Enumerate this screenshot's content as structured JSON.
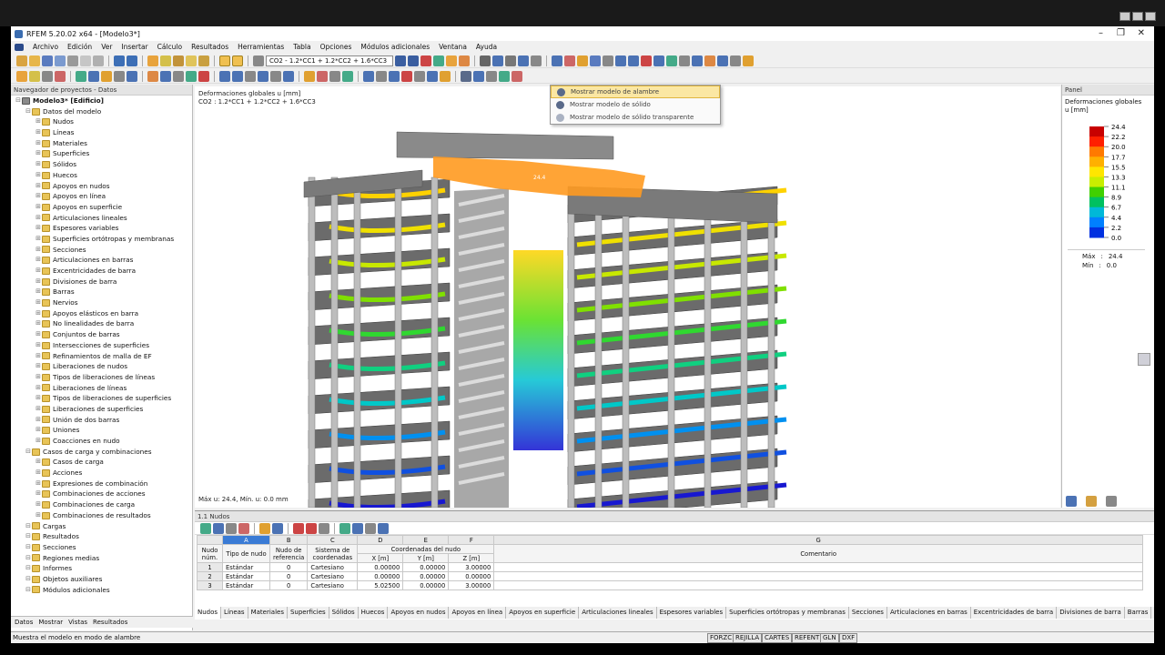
{
  "window": {
    "title": "RFEM 5.20.02 x64 - [Modelo3*]"
  },
  "menu": [
    "Archivo",
    "Edición",
    "Ver",
    "Insertar",
    "Cálculo",
    "Resultados",
    "Herramientas",
    "Tabla",
    "Opciones",
    "Módulos adicionales",
    "Ventana",
    "Ayuda"
  ],
  "toolbar": {
    "load_combo": "CO2 - 1.2*CC1 + 1.2*CC2 + 1.6*CC3"
  },
  "navigator": {
    "title": "Navegador de proyectos - Datos",
    "items": [
      {
        "label": "Modelo3* [Edificio]",
        "level": 0,
        "bold": true
      },
      {
        "label": "Datos del modelo",
        "level": 1
      },
      {
        "label": "Nudos",
        "level": 2
      },
      {
        "label": "Líneas",
        "level": 2
      },
      {
        "label": "Materiales",
        "level": 2
      },
      {
        "label": "Superficies",
        "level": 2
      },
      {
        "label": "Sólidos",
        "level": 2
      },
      {
        "label": "Huecos",
        "level": 2
      },
      {
        "label": "Apoyos en nudos",
        "level": 2
      },
      {
        "label": "Apoyos en línea",
        "level": 2
      },
      {
        "label": "Apoyos en superficie",
        "level": 2
      },
      {
        "label": "Articulaciones lineales",
        "level": 2
      },
      {
        "label": "Espesores variables",
        "level": 2
      },
      {
        "label": "Superficies ortótropas y membranas",
        "level": 2
      },
      {
        "label": "Secciones",
        "level": 2
      },
      {
        "label": "Articulaciones en barras",
        "level": 2
      },
      {
        "label": "Excentricidades de barra",
        "level": 2
      },
      {
        "label": "Divisiones de barra",
        "level": 2
      },
      {
        "label": "Barras",
        "level": 2
      },
      {
        "label": "Nervios",
        "level": 2
      },
      {
        "label": "Apoyos elásticos en barra",
        "level": 2
      },
      {
        "label": "No linealidades de barra",
        "level": 2
      },
      {
        "label": "Conjuntos de barras",
        "level": 2
      },
      {
        "label": "Intersecciones de superficies",
        "level": 2
      },
      {
        "label": "Refinamientos de malla de EF",
        "level": 2
      },
      {
        "label": "Liberaciones de nudos",
        "level": 2
      },
      {
        "label": "Tipos de liberaciones de líneas",
        "level": 2
      },
      {
        "label": "Liberaciones de líneas",
        "level": 2
      },
      {
        "label": "Tipos de liberaciones de superficies",
        "level": 2
      },
      {
        "label": "Liberaciones de superficies",
        "level": 2
      },
      {
        "label": "Unión de dos barras",
        "level": 2
      },
      {
        "label": "Uniones",
        "level": 2
      },
      {
        "label": "Coacciones en nudo",
        "level": 2
      },
      {
        "label": "Casos de carga y combinaciones",
        "level": 1
      },
      {
        "label": "Casos de carga",
        "level": 2
      },
      {
        "label": "Acciones",
        "level": 2
      },
      {
        "label": "Expresiones de combinación",
        "level": 2
      },
      {
        "label": "Combinaciones de acciones",
        "level": 2
      },
      {
        "label": "Combinaciones de carga",
        "level": 2
      },
      {
        "label": "Combinaciones de resultados",
        "level": 2
      },
      {
        "label": "Cargas",
        "level": 1
      },
      {
        "label": "Resultados",
        "level": 1
      },
      {
        "label": "Secciones",
        "level": 1
      },
      {
        "label": "Regiones medias",
        "level": 1
      },
      {
        "label": "Informes",
        "level": 1
      },
      {
        "label": "Objetos auxiliares",
        "level": 1
      },
      {
        "label": "Módulos adicionales",
        "level": 1
      }
    ],
    "tabs": [
      "Datos",
      "Mostrar",
      "Vistas",
      "Resultados"
    ]
  },
  "viewport": {
    "title": "Deformaciones globales u [mm]",
    "combo": "CO2 : 1.2*CC1 + 1.2*CC2 + 1.6*CC3",
    "minmax": "Máx u: 24.4, Mín. u: 0.0 mm",
    "roof_value": "24.4"
  },
  "context_menu": [
    "Mostrar modelo de alambre",
    "Mostrar modelo de sólido",
    "Mostrar modelo de sólido transparente"
  ],
  "panel": {
    "title": "Panel",
    "heading": "Deformaciones globales",
    "unit": "u [mm]",
    "values": [
      "24.4",
      "22.2",
      "20.0",
      "17.7",
      "15.5",
      "13.3",
      "11.1",
      "8.9",
      "6.7",
      "4.4",
      "2.2",
      "0.0"
    ],
    "colors": [
      "#c80000",
      "#ff2000",
      "#ff7a00",
      "#ffb000",
      "#ffe600",
      "#c8ee00",
      "#40d000",
      "#00c060",
      "#00b8d8",
      "#0080ff",
      "#0030e0",
      "#1a00b0"
    ],
    "max_label": "Máx",
    "max_value": "24.4",
    "min_label": "Mín",
    "min_value": "0.0"
  },
  "table": {
    "title": "1.1 Nudos",
    "col_letters": [
      "A",
      "B",
      "C",
      "D",
      "E",
      "F",
      "G"
    ],
    "headers": {
      "num": "Nudo núm.",
      "tipo": "Tipo de nudo",
      "ref": "Nudo de referencia",
      "sistema": "Sistema de coordenadas",
      "coords": "Coordenadas del nudo",
      "x": "X [m]",
      "y": "Y [m]",
      "z": "Z [m]",
      "comentario": "Comentario"
    },
    "rows": [
      [
        "1",
        "Estándar",
        "0",
        "Cartesiano",
        "0.00000",
        "0.00000",
        "3.00000"
      ],
      [
        "2",
        "Estándar",
        "0",
        "Cartesiano",
        "0.00000",
        "0.00000",
        "0.00000"
      ],
      [
        "3",
        "Estándar",
        "0",
        "Cartesiano",
        "5.02500",
        "0.00000",
        "3.00000"
      ]
    ],
    "tabs": [
      "Nudos",
      "Líneas",
      "Materiales",
      "Superficies",
      "Sólidos",
      "Huecos",
      "Apoyos en nudos",
      "Apoyos en línea",
      "Apoyos en superficie",
      "Articulaciones lineales",
      "Espesores variables",
      "Superficies ortótropas y membranas",
      "Secciones",
      "Articulaciones en barras",
      "Excentricidades de barra",
      "Divisiones de barra",
      "Barras"
    ]
  },
  "status": {
    "text": "Muestra el modelo en modo de alambre",
    "buttons": [
      "FORZC",
      "REJILLA",
      "CARTES",
      "REFENT",
      "GLN",
      "DXF"
    ]
  }
}
